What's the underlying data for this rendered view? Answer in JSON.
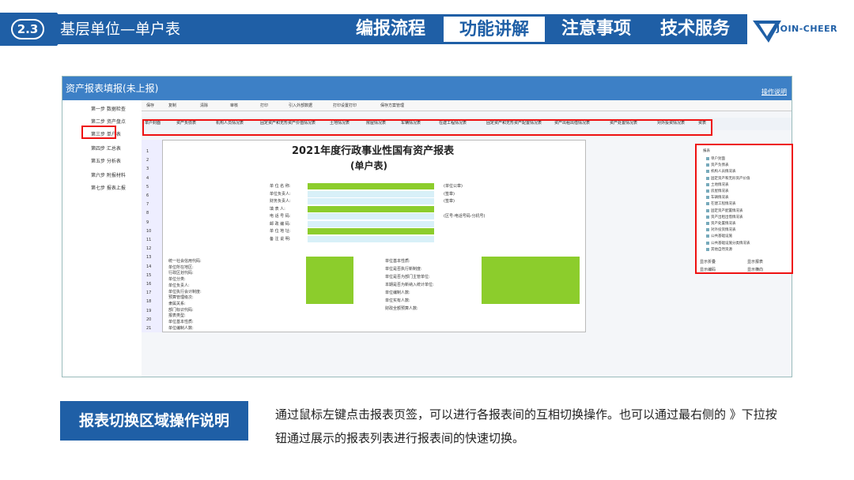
{
  "header": {
    "number": "2.3",
    "title": "基层单位—单户表",
    "tabs": [
      {
        "label": "编报流程",
        "active": false
      },
      {
        "label": "功能讲解",
        "active": true
      },
      {
        "label": "注意事项",
        "active": false
      },
      {
        "label": "技术服务",
        "active": false
      }
    ],
    "logo_text": "JOIN-CHEER"
  },
  "app": {
    "title": "资产报表填报(未上报)",
    "help": "操作说明",
    "steps": [
      "第一步 数据检查",
      "第二步 资产盘点",
      "第三步 单户表",
      "第四步 汇总表",
      "第五步 分析表",
      "第六步 附报材料",
      "第七步 报表上报"
    ],
    "toolbar": [
      "保存",
      "复制",
      "清除",
      "审核",
      "打印",
      "引入外部数据",
      "打印设置打印",
      "保存方案管理"
    ],
    "sheet_tabs": [
      "单户封面",
      "资产负债表",
      "机构人员情况表",
      "固定资产和无形资产价值情况表",
      "土地情况表",
      "房屋情况表",
      "车辆情况表",
      "在建工程情况表",
      "固定资产和无形资产配置情况表",
      "资产出租出借情况表",
      "资产处置情况表",
      "对外投资情况表",
      "资表"
    ],
    "report_title": "2021年度行政事业性国有资产报表",
    "report_sub": "(单户表)",
    "row_numbers": [
      "1",
      "2",
      "3",
      "4",
      "5",
      "6",
      "7",
      "8",
      "9",
      "10",
      "11",
      "12",
      "13",
      "14",
      "15",
      "16",
      "17",
      "18",
      "19",
      "20",
      "21"
    ],
    "form_labels": [
      "单 位 名 称:",
      "单位负责人:",
      "财务负责人:",
      "填 表 人:",
      "电 话 号 码:",
      "邮 政 编 码:",
      "单 位 地 址:",
      "备 注 说 明:"
    ],
    "form_notes": [
      "(单位公章)",
      "(签章)",
      "(签章)",
      "(区号-电话号码-分机号)"
    ],
    "grid_labels": [
      "统一社会信用代码:",
      "单位所在地区:",
      "行政区划代码:",
      "单位分类:",
      "单位负责人:",
      "单位执行会计制度:",
      "预算管理级次:",
      "隶属关系:",
      "部门标识代码:",
      "报表类型:",
      "单位基本性质:",
      "单位编制人数:",
      "备用码:"
    ],
    "grid_right_labels": [
      "单位基本性质:",
      "单位是否执行新制度:",
      "单位是否为部门主管单位:",
      "本期是否为新纳入统计单位:",
      "单位编制人数:",
      "单位实有人数:",
      "财政全额预算人数:"
    ],
    "panel_root": "报表",
    "panel_items": [
      "单户封面",
      "资产负债表",
      "机构人员情况表",
      "固定资产和无形资产价值",
      "土地情况表",
      "房屋情况表",
      "车辆情况表",
      "在建工程情况表",
      "固定资产配置情况表",
      "资产出租出借情况表",
      "资产处置情况表",
      "对外投资情况表",
      "公共基础设施",
      "公共基础设施分类情况表",
      "其他自然资源"
    ],
    "options": [
      "显示折叠",
      "显示报表",
      "显示编码",
      "显示横向"
    ]
  },
  "caption": {
    "label": "报表切换区域操作说明",
    "text": "通过鼠标左键点击报表页签，可以进行各报表间的互相切换操作。也可以通过最右侧的 》下拉按钮通过展示的报表列表进行报表间的快速切换。"
  }
}
